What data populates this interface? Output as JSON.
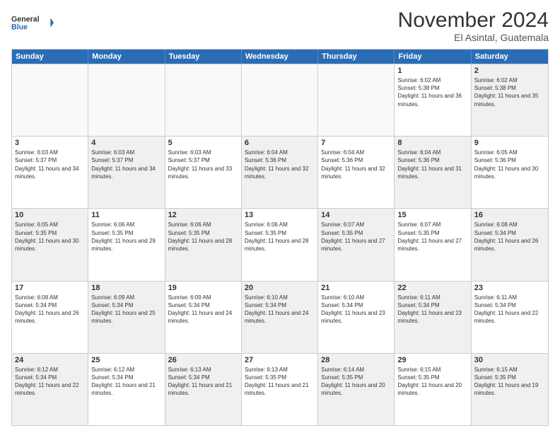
{
  "header": {
    "logo_general": "General",
    "logo_blue": "Blue",
    "month_title": "November 2024",
    "subtitle": "El Asintal, Guatemala"
  },
  "days_of_week": [
    "Sunday",
    "Monday",
    "Tuesday",
    "Wednesday",
    "Thursday",
    "Friday",
    "Saturday"
  ],
  "weeks": [
    [
      {
        "day": "",
        "empty": true
      },
      {
        "day": "",
        "empty": true
      },
      {
        "day": "",
        "empty": true
      },
      {
        "day": "",
        "empty": true
      },
      {
        "day": "",
        "empty": true
      },
      {
        "day": "1",
        "sunrise": "6:02 AM",
        "sunset": "5:38 PM",
        "daylight": "11 hours and 36 minutes."
      },
      {
        "day": "2",
        "shaded": true,
        "sunrise": "6:02 AM",
        "sunset": "5:38 PM",
        "daylight": "11 hours and 35 minutes."
      }
    ],
    [
      {
        "day": "3",
        "sunrise": "6:03 AM",
        "sunset": "5:37 PM",
        "daylight": "11 hours and 34 minutes."
      },
      {
        "day": "4",
        "shaded": true,
        "sunrise": "6:03 AM",
        "sunset": "5:37 PM",
        "daylight": "11 hours and 34 minutes."
      },
      {
        "day": "5",
        "sunrise": "6:03 AM",
        "sunset": "5:37 PM",
        "daylight": "11 hours and 33 minutes."
      },
      {
        "day": "6",
        "shaded": true,
        "sunrise": "6:04 AM",
        "sunset": "5:36 PM",
        "daylight": "11 hours and 32 minutes."
      },
      {
        "day": "7",
        "sunrise": "6:04 AM",
        "sunset": "5:36 PM",
        "daylight": "11 hours and 32 minutes."
      },
      {
        "day": "8",
        "shaded": true,
        "sunrise": "6:04 AM",
        "sunset": "5:36 PM",
        "daylight": "11 hours and 31 minutes."
      },
      {
        "day": "9",
        "sunrise": "6:05 AM",
        "sunset": "5:36 PM",
        "daylight": "11 hours and 30 minutes."
      }
    ],
    [
      {
        "day": "10",
        "shaded": true,
        "sunrise": "6:05 AM",
        "sunset": "5:35 PM",
        "daylight": "11 hours and 30 minutes."
      },
      {
        "day": "11",
        "sunrise": "6:06 AM",
        "sunset": "5:35 PM",
        "daylight": "11 hours and 29 minutes."
      },
      {
        "day": "12",
        "shaded": true,
        "sunrise": "6:06 AM",
        "sunset": "5:35 PM",
        "daylight": "11 hours and 28 minutes."
      },
      {
        "day": "13",
        "sunrise": "6:06 AM",
        "sunset": "5:35 PM",
        "daylight": "11 hours and 28 minutes."
      },
      {
        "day": "14",
        "shaded": true,
        "sunrise": "6:07 AM",
        "sunset": "5:35 PM",
        "daylight": "11 hours and 27 minutes."
      },
      {
        "day": "15",
        "sunrise": "6:07 AM",
        "sunset": "5:35 PM",
        "daylight": "11 hours and 27 minutes."
      },
      {
        "day": "16",
        "shaded": true,
        "sunrise": "6:08 AM",
        "sunset": "5:34 PM",
        "daylight": "11 hours and 26 minutes."
      }
    ],
    [
      {
        "day": "17",
        "sunrise": "6:08 AM",
        "sunset": "5:34 PM",
        "daylight": "11 hours and 26 minutes."
      },
      {
        "day": "18",
        "shaded": true,
        "sunrise": "6:09 AM",
        "sunset": "5:34 PM",
        "daylight": "11 hours and 25 minutes."
      },
      {
        "day": "19",
        "sunrise": "6:09 AM",
        "sunset": "5:34 PM",
        "daylight": "11 hours and 24 minutes."
      },
      {
        "day": "20",
        "shaded": true,
        "sunrise": "6:10 AM",
        "sunset": "5:34 PM",
        "daylight": "11 hours and 24 minutes."
      },
      {
        "day": "21",
        "sunrise": "6:10 AM",
        "sunset": "5:34 PM",
        "daylight": "11 hours and 23 minutes."
      },
      {
        "day": "22",
        "shaded": true,
        "sunrise": "6:11 AM",
        "sunset": "5:34 PM",
        "daylight": "11 hours and 23 minutes."
      },
      {
        "day": "23",
        "sunrise": "6:11 AM",
        "sunset": "5:34 PM",
        "daylight": "11 hours and 22 minutes."
      }
    ],
    [
      {
        "day": "24",
        "shaded": true,
        "sunrise": "6:12 AM",
        "sunset": "5:34 PM",
        "daylight": "11 hours and 22 minutes."
      },
      {
        "day": "25",
        "sunrise": "6:12 AM",
        "sunset": "5:34 PM",
        "daylight": "11 hours and 21 minutes."
      },
      {
        "day": "26",
        "shaded": true,
        "sunrise": "6:13 AM",
        "sunset": "5:34 PM",
        "daylight": "11 hours and 21 minutes."
      },
      {
        "day": "27",
        "sunrise": "6:13 AM",
        "sunset": "5:35 PM",
        "daylight": "11 hours and 21 minutes."
      },
      {
        "day": "28",
        "shaded": true,
        "sunrise": "6:14 AM",
        "sunset": "5:35 PM",
        "daylight": "11 hours and 20 minutes."
      },
      {
        "day": "29",
        "sunrise": "6:15 AM",
        "sunset": "5:35 PM",
        "daylight": "11 hours and 20 minutes."
      },
      {
        "day": "30",
        "shaded": true,
        "sunrise": "6:15 AM",
        "sunset": "5:35 PM",
        "daylight": "11 hours and 19 minutes."
      }
    ]
  ]
}
